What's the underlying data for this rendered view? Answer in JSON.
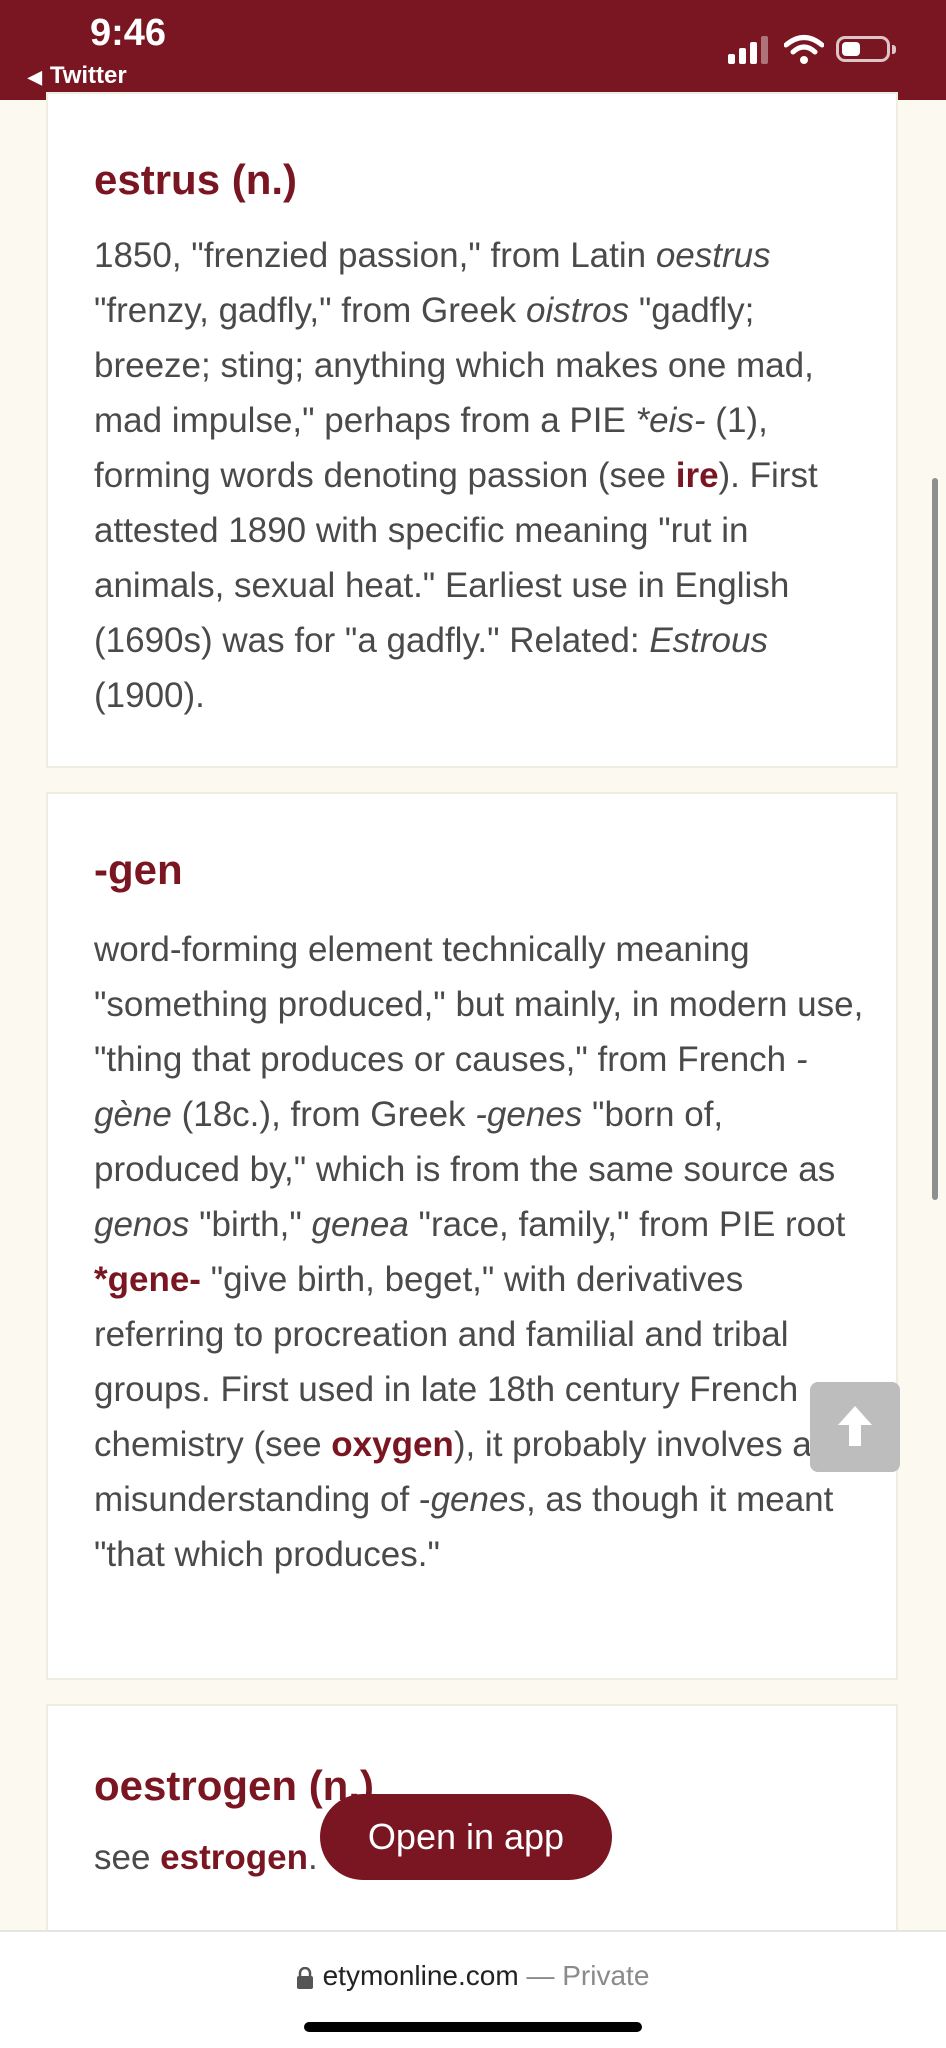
{
  "status": {
    "time": "9:46",
    "back_app": "Twitter"
  },
  "entries": [
    {
      "headword": "estrus (n.)",
      "body": [
        {
          "t": "1850, \"frenzied passion,\" from Latin "
        },
        {
          "i": "oestrus"
        },
        {
          "t": " \"frenzy, gadfly,\" from Greek "
        },
        {
          "i": "oistros"
        },
        {
          "t": " \"gadfly; breeze; sting; anything which makes one mad, mad impulse,\" perhaps from a PIE "
        },
        {
          "i": "*eis-"
        },
        {
          "t": " (1), forming words denoting passion (see "
        },
        {
          "l": "ire"
        },
        {
          "t": "). First attested 1890 with specific meaning \"rut in animals, sexual heat.\" Earliest use in English (1690s) was for \"a gadfly.\" Related: "
        },
        {
          "i": "Estrous"
        },
        {
          "t": " (1900)."
        }
      ]
    },
    {
      "headword": "-gen",
      "body": [
        {
          "t": "word-forming element technically meaning \"something produced,\" but mainly, in modern use, \"thing that produces or causes,\" from French "
        },
        {
          "i": "-gène"
        },
        {
          "t": " (18c.), from Greek "
        },
        {
          "i": "-genes"
        },
        {
          "t": " \"born of, produced by,\" which is from the same source as "
        },
        {
          "i": "genos"
        },
        {
          "t": " \"birth,\" "
        },
        {
          "i": "genea"
        },
        {
          "t": " \"race, family,\" from PIE root "
        },
        {
          "l": "*gene-"
        },
        {
          "t": " \"give birth, beget,\" with derivatives referring to procreation and familial and tribal groups. First used in late 18th century French chemistry (see "
        },
        {
          "l": "oxygen"
        },
        {
          "t": "), it probably involves a misunderstanding of -"
        },
        {
          "i": "genes"
        },
        {
          "t": ", as though it meant \"that which produces.\""
        }
      ]
    },
    {
      "headword": "oestrogen (n.)",
      "body": [
        {
          "t": "see "
        },
        {
          "l": "estrogen"
        },
        {
          "t": "."
        }
      ]
    }
  ],
  "open_in_app": "Open in app",
  "toolbar": {
    "domain": "etymonline.com",
    "private": " — Private"
  },
  "icons": {
    "back": "back-triangle-icon",
    "signal": "cellular-signal-icon",
    "wifi": "wifi-icon",
    "battery": "battery-icon",
    "scroll_top": "arrow-up-icon",
    "lock": "lock-icon"
  },
  "colors": {
    "brand": "#7a1622",
    "page_bg": "#fcf9f1"
  }
}
